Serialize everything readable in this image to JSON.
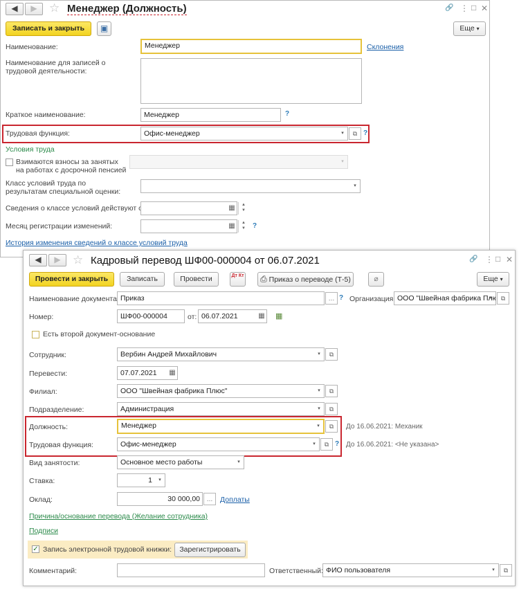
{
  "w1": {
    "title": "Менеджер (Должность)",
    "save_close": "Записать и закрыть",
    "more": "Еще",
    "name_label": "Наименование:",
    "name_value": "Менеджер",
    "declensions": "Склонения",
    "labor_name_label": "Наименование для записей о трудовой деятельности:",
    "short_name_label": "Краткое наименование:",
    "short_name_value": "Менеджер",
    "labor_func_label": "Трудовая функция:",
    "labor_func_value": "Офис-менеджер",
    "work_conditions": "Условия труда",
    "contrib_label": "Взимаются взносы за занятых на работах с досрочной пенсией",
    "class_label": "Класс условий труда по результатам специальной оценки:",
    "class_valid_label": "Сведения о классе условий действуют с:",
    "reg_month_label": "Месяц регистрации изменений:",
    "history_link": "История изменения сведений о классе условий труда",
    "help": "?"
  },
  "w2": {
    "title": "Кадровый перевод ШФ00-000004 от 06.07.2021",
    "post_close": "Провести и закрыть",
    "save": "Записать",
    "post": "Провести",
    "dtkt": "Дт Кт",
    "print_order": "Приказ о переводе (Т-5)",
    "more": "Еще",
    "doc_name_label": "Наименование документа:",
    "doc_name_value": "Приказ",
    "org_label": "Организация:",
    "org_value": "ООО \"Швейная фабрика Плю",
    "number_label": "Номер:",
    "number_value": "ШФ00-000004",
    "from_label": "от:",
    "date_value": "06.07.2021",
    "second_basis": "Есть второй документ-основание",
    "employee_label": "Сотрудник:",
    "employee_value": "Вербин Андрей Михайлович",
    "transfer_label": "Перевести:",
    "transfer_value": "07.07.2021",
    "branch_label": "Филиал:",
    "branch_value": "ООО \"Швейная фабрика Плюс\"",
    "dept_label": "Подразделение:",
    "dept_value": "Администрация",
    "position_label": "Должность:",
    "position_value": "Менеджер",
    "position_hint": "До 16.06.2021: Механик",
    "labor_func_label": "Трудовая функция:",
    "labor_func_value": "Офис-менеджер",
    "labor_func_hint": "До 16.06.2021: <Не указана>",
    "employment_label": "Вид занятости:",
    "employment_value": "Основное место работы",
    "rate_label": "Ставка:",
    "rate_value": "1",
    "salary_label": "Оклад:",
    "salary_value": "30 000,00",
    "allowances": "Доплаты",
    "reason_link": "Причина/основание перевода (Желание сотрудника)",
    "signatures": "Подписи",
    "ewb_label": "Запись электронной трудовой книжки:",
    "register": "Зарегистрировать",
    "comment_label": "Комментарий:",
    "responsible_label": "Ответственный:",
    "responsible_value": "ФИО пользователя",
    "help": "?"
  },
  "icons": {
    "back": "◀",
    "forward": "▶",
    "star": "☆",
    "link": "🔗",
    "menu": "⋮",
    "maximize": "□",
    "close": "✕",
    "dropdown": "▾",
    "open": "⧉",
    "calendar": "▦",
    "spin_up": "▲",
    "spin_down": "▼",
    "check": "✓",
    "printer": "⎙",
    "clip": "⌀",
    "floppy": "▣",
    "ellipsis": "…"
  },
  "colors": {
    "accent_yellow": "#f2d321",
    "highlight_red": "#c9262f",
    "link_blue": "#1a5fa8",
    "section_green": "#2b8a4a"
  }
}
